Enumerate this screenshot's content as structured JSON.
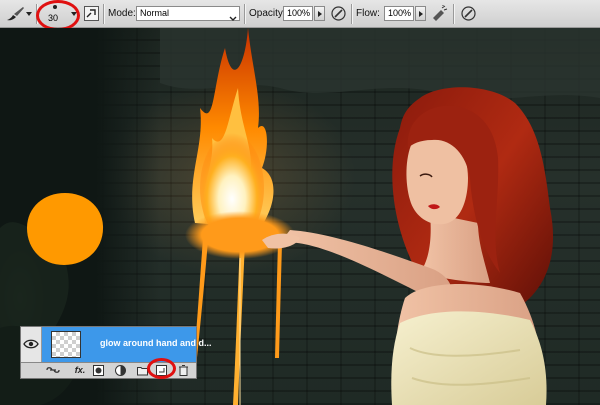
{
  "options_bar": {
    "tool_icon": "brush-icon",
    "brush_size": "30",
    "brush_panel_icon": "brush-panel-toggle-icon",
    "mode_label": "Mode:",
    "mode_value": "Normal",
    "opacity_label": "Opacity:",
    "opacity_value": "100%",
    "opacity_pressure_icon": "tablet-pressure-opacity-icon",
    "flow_label": "Flow:",
    "flow_value": "100%",
    "airbrush_icon": "airbrush-icon",
    "flow_pressure_icon": "tablet-pressure-size-icon"
  },
  "canvas": {
    "brush_preview_color": "#ff9900",
    "glow_color": "#ff9a1a"
  },
  "layers_panel": {
    "layer_name": "glow around hand and d...",
    "visibility_icon": "eye-icon",
    "footer_buttons": [
      "link-layers-icon",
      "fx-icon",
      "add-mask-icon",
      "adjustment-layer-icon",
      "new-group-icon",
      "new-layer-icon",
      "trash-icon"
    ],
    "fx_label": "fx."
  },
  "annotations": {
    "highlight_color": "#e01010"
  }
}
